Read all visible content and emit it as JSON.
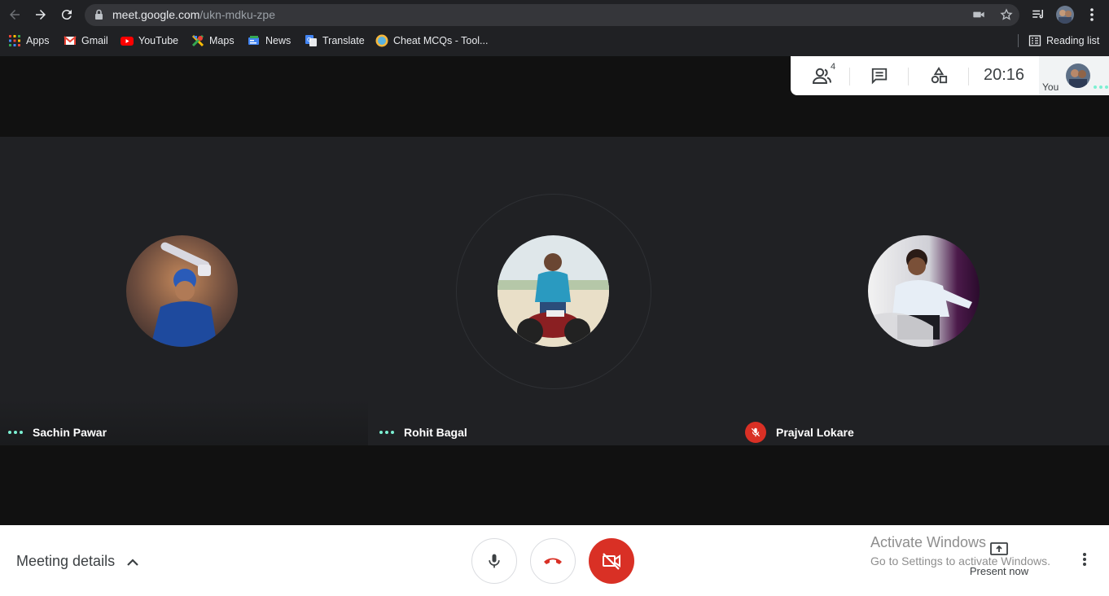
{
  "browser": {
    "url_host": "meet.google.com",
    "url_path": "/ukn-mdku-zpe",
    "bookmarks": [
      {
        "label": "Apps",
        "icon": "apps-grid-icon"
      },
      {
        "label": "Gmail",
        "icon": "gmail-icon"
      },
      {
        "label": "YouTube",
        "icon": "youtube-icon"
      },
      {
        "label": "Maps",
        "icon": "maps-icon"
      },
      {
        "label": "News",
        "icon": "news-icon"
      },
      {
        "label": "Translate",
        "icon": "translate-icon"
      },
      {
        "label": "Cheat MCQs - Tool...",
        "icon": "cheat-mcqs-icon"
      }
    ],
    "reading_list": "Reading list"
  },
  "meet": {
    "participants_count": "4",
    "time": "20:16",
    "you_label": "You",
    "participants": [
      {
        "name": "Sachin Pawar",
        "status": "speaking-dots"
      },
      {
        "name": "Rohit Bagal",
        "status": "speaking-dots"
      },
      {
        "name": "Prajval Lokare",
        "status": "muted"
      }
    ],
    "meeting_details": "Meeting details",
    "present_now": "Present now",
    "watermark_title": "Activate Windows",
    "watermark_sub": "Go to Settings to activate Windows."
  },
  "colors": {
    "accent_teal": "#7cf0d2",
    "end_red": "#d93025",
    "browser_bg": "#202124"
  }
}
